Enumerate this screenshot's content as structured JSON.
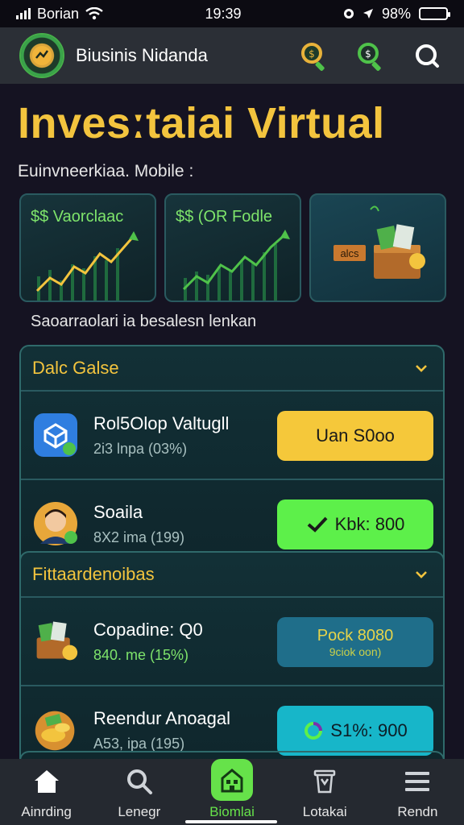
{
  "status": {
    "carrier": "Borian",
    "time": "19:39",
    "battery": "98%"
  },
  "app": {
    "name": "Biusinis Nidanda"
  },
  "hero": {
    "title": "Invesːtaiai Virtual",
    "subtitle": "Euinvneerkiaa. Mobile :"
  },
  "cards": [
    {
      "label": "$$ Vaorclaac"
    },
    {
      "label": "$$ (OR Fodle"
    },
    {
      "label": "alcs"
    }
  ],
  "caption": "Saoarraolari ia besalesn  lenkan",
  "panel1": {
    "title": "Dalc Galse",
    "items": [
      {
        "title": "Rol5Olop Valtugll",
        "sub": "2i3 lnpa (03%)",
        "button": "Uan S0oo"
      },
      {
        "title": "Soaila",
        "sub": "8X2 ima (199)",
        "button": "Kbk: 800"
      }
    ]
  },
  "panel2": {
    "title": "Fittaardenoibas",
    "items": [
      {
        "title": "Copadine: Q0",
        "sub": "840. me (15%)",
        "button": "Pock 8080",
        "button_sub": "9ciok oon)"
      },
      {
        "title": "Reendur Anoagal",
        "sub": "A53, ipa (195)",
        "button": "S1%: 900"
      }
    ]
  },
  "nav": [
    {
      "label": "Ainrding",
      "icon": "home-icon"
    },
    {
      "label": "Lenegr",
      "icon": "search-icon"
    },
    {
      "label": "Biomlai",
      "icon": "building-icon",
      "active": true
    },
    {
      "label": "Lotakai",
      "icon": "bin-icon"
    },
    {
      "label": "Rendn",
      "icon": "menu-icon"
    }
  ],
  "colors": {
    "accent": "#f3c43e",
    "green": "#5df04a",
    "background": "#151322"
  }
}
